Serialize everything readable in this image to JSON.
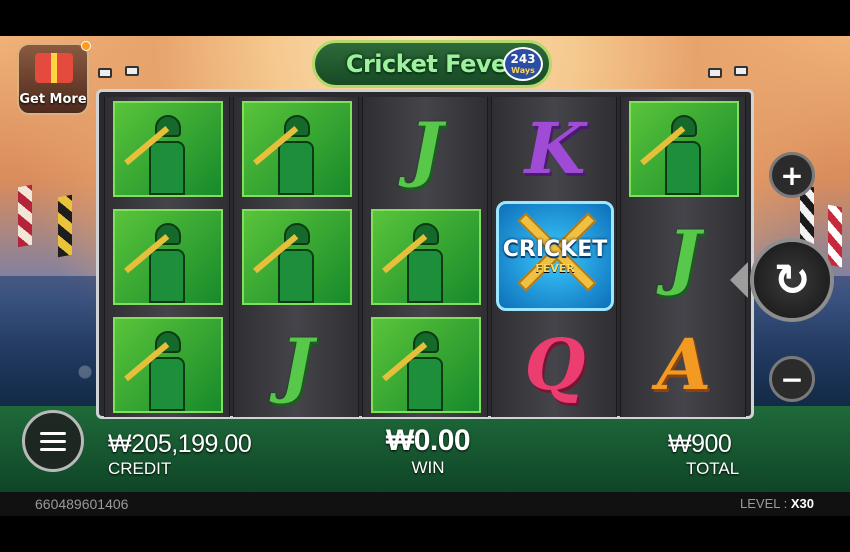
{
  "game": {
    "logo_text": "Cricket Fever",
    "logo_ways_number": "243",
    "logo_ways_word": "Ways"
  },
  "promo": {
    "get_more_label": "Get More"
  },
  "reels": [
    [
      "batsman",
      "batsman",
      "batsman"
    ],
    [
      "batsman",
      "batsman",
      "J"
    ],
    [
      "J",
      "batsman",
      "batsman"
    ],
    [
      "K",
      "scatter",
      "Q"
    ],
    [
      "batsman",
      "J",
      "A"
    ]
  ],
  "symbols": {
    "J": "J",
    "K": "K",
    "Q": "Q",
    "A": "A",
    "scatter_title": "CRICKET",
    "scatter_subtitle": "FEVER"
  },
  "controls": {
    "plus": "+",
    "minus": "−",
    "spin": "↻"
  },
  "meters": {
    "credit_value": "₩205,199.00",
    "credit_label": "CREDIT",
    "win_value": "₩0.00",
    "win_label": "WIN",
    "total_value": "₩900",
    "total_label": "TOTAL"
  },
  "status": {
    "session_id": "660489601406",
    "level_label": "LEVEL :",
    "level_value": "X30"
  },
  "colors": {
    "batsman_bg": "#3aa83a",
    "J": "#57c84a",
    "K": "#9f4bd6",
    "Q": "#ec3d70",
    "A": "#f39a22",
    "scatter_bg": "#1a9ae0"
  }
}
